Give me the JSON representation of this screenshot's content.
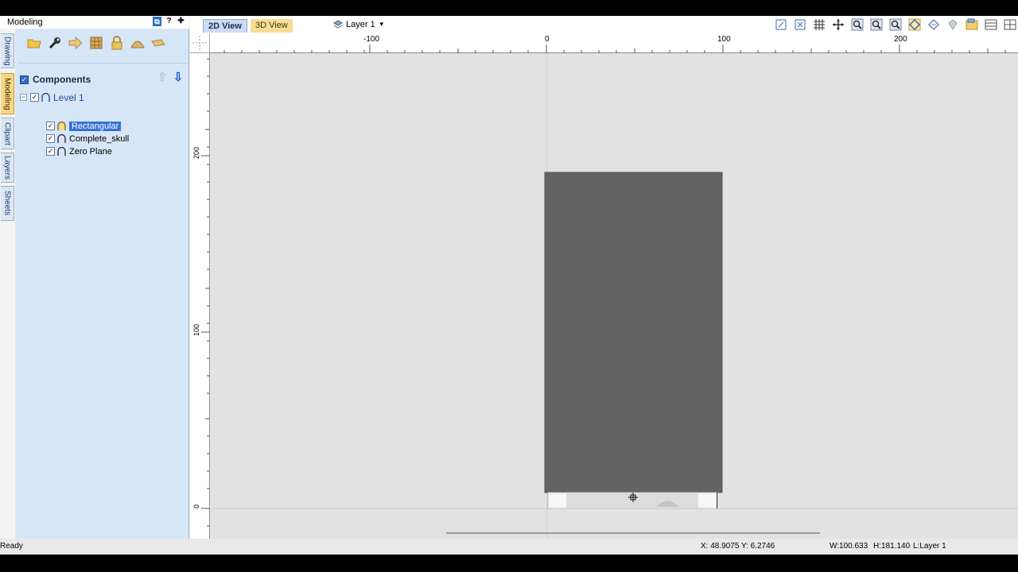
{
  "window": {
    "panel_title": "Modeling",
    "panel_controls": [
      "⧉",
      "?",
      "✚"
    ]
  },
  "vertical_tabs": [
    {
      "label": "Drawing",
      "active": false
    },
    {
      "label": "Modeling",
      "active": true
    },
    {
      "label": "Clipart",
      "active": false
    },
    {
      "label": "Layers",
      "active": false
    },
    {
      "label": "Sheets",
      "active": false
    }
  ],
  "modeling_toolbar": [
    "open-folder-icon",
    "wrench-icon",
    "arrow-right-icon",
    "texture-icon",
    "lock-icon",
    "dome-icon",
    "wedge-icon"
  ],
  "components": {
    "label": "Components",
    "checked": true,
    "tree": {
      "level": {
        "label": "Level 1",
        "expanded": true,
        "checked": true
      },
      "items": [
        {
          "label": "Rectangular",
          "checked": true,
          "selected": true
        },
        {
          "label": "Complete_skull",
          "checked": true,
          "selected": false
        },
        {
          "label": "Zero Plane",
          "checked": true,
          "selected": false
        }
      ]
    }
  },
  "view_tabs": {
    "tab_2d": "2D View",
    "tab_3d": "3D View",
    "active": "3D View",
    "layer": "Layer 1"
  },
  "view_tools": [
    "zoom-extents-icon",
    "fit-selection-icon",
    "grid-icon",
    "pan-icon",
    "zoom-icon",
    "zoom-in-icon",
    "zoom-out-icon",
    "rotate-icon",
    "refresh-icon",
    "shade-icon",
    "layers-icon",
    "window-icon",
    "split-icon"
  ],
  "rulers": {
    "h_labels": [
      {
        "label": "-100"
      },
      {
        "label": "0"
      },
      {
        "label": "100"
      },
      {
        "label": "200"
      }
    ],
    "v_labels": [
      {
        "label": "200"
      },
      {
        "label": "100"
      },
      {
        "label": "0"
      }
    ]
  },
  "status": {
    "ready": "Ready",
    "xy": "X: 48.9075 Y:  6.2746",
    "w": "W:100.633",
    "h": "H:181.140",
    "layer": "L:Layer 1"
  },
  "colors": {
    "canvas": "#e2e2e2",
    "model_rect": "#636363",
    "panel": "#d6e6f7",
    "selected": "#3372d3",
    "active_tab": "#f7dd94"
  }
}
